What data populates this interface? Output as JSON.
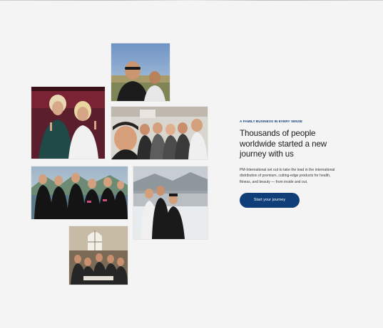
{
  "section": {
    "eyebrow": "A FAMILY BUSINESS IN EVERY SENSE",
    "headline": "Thousands of people worldwide started a new journey with us",
    "body": "PM-International set out to take the lead in the international distribution of premium, cutting-edge products for health, fitness, and beauty — from inside and out.",
    "cta_label": "Start your journey"
  },
  "colors": {
    "accent": "#0f3e78",
    "background": "#f4f4f4"
  },
  "photos": [
    {
      "name": "couple-selfie-outdoors"
    },
    {
      "name": "two-women-on-stage"
    },
    {
      "name": "group-selfie-indoors"
    },
    {
      "name": "team-group-photo"
    },
    {
      "name": "people-in-snow"
    },
    {
      "name": "group-dinner-photo"
    }
  ]
}
